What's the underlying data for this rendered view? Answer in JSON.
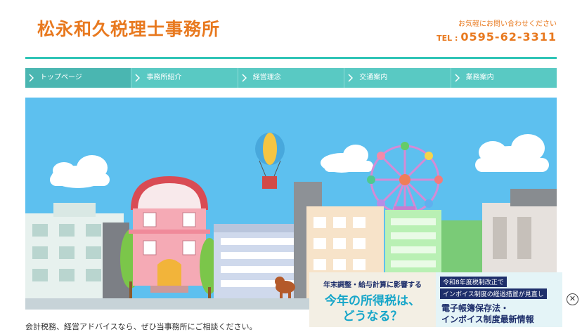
{
  "header": {
    "title": "松永和久税理士事務所",
    "contact_note": "お気軽にお問い合わせください",
    "tel_label": "TEL :",
    "tel_number": "0595-62-3311"
  },
  "nav": {
    "items": [
      {
        "label": "トップページ"
      },
      {
        "label": "事務所紹介"
      },
      {
        "label": "経営理念"
      },
      {
        "label": "交通案内"
      },
      {
        "label": "業務案内"
      }
    ]
  },
  "body_text": "会計税務、経営アドバイスなら、ぜひ当事務所にご相談ください。",
  "ads": {
    "banner1": {
      "line1": "年末調整・給与計算に影響する",
      "line2": "今年の所得税は、",
      "line3": "どうなる？"
    },
    "banner2": {
      "tag1": "令和8年度税制改正で",
      "tag2": "インボイス制度の経過措置が見直し",
      "line1": "電子帳簿保存法・",
      "line2": "インボイス制度最新情報"
    },
    "close_symbol": "✕"
  },
  "colors": {
    "brand_orange": "#e8791f",
    "teal": "#2fc4b6",
    "nav_bg": "#59c9c3",
    "sky": "#5dc0ef"
  }
}
